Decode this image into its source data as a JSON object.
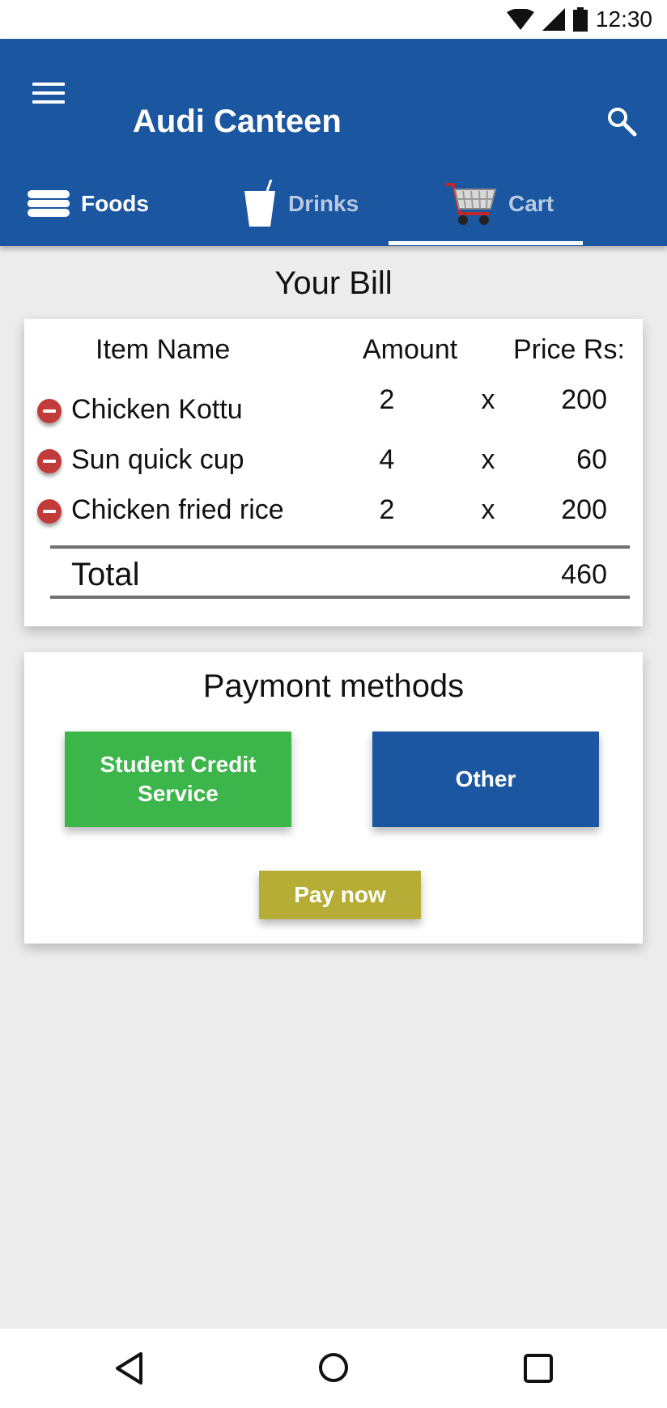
{
  "status_bar": {
    "time": "12:30"
  },
  "app_bar": {
    "title": "Audi Canteen"
  },
  "tabs": [
    {
      "label": "Foods",
      "icon": "burger-icon"
    },
    {
      "label": "Drinks",
      "icon": "drink-cup-icon"
    },
    {
      "label": "Cart",
      "icon": "shopping-cart-icon",
      "selected": true
    }
  ],
  "bill": {
    "title": "Your Bill",
    "headers": {
      "item": "Item Name",
      "amount": "Amount",
      "price": "Price Rs:"
    },
    "items": [
      {
        "name": "Chicken Kottu",
        "amount": "2",
        "times": "x",
        "price": "200"
      },
      {
        "name": "Sun quick cup",
        "amount": "4",
        "times": "x",
        "price": "60"
      },
      {
        "name": "Chicken fried rice",
        "amount": "2",
        "times": "x",
        "price": "200"
      }
    ],
    "total_label": "Total",
    "total_value": "460"
  },
  "payment": {
    "title": "Paymont methods",
    "student_credit_line1": "Student Credit",
    "student_credit_line2": "Service",
    "other": "Other",
    "pay_now": "Pay now"
  },
  "colors": {
    "primary": "#1b56a0",
    "student_credit": "#3cb54a",
    "pay_now": "#b5ad35",
    "remove": "#c23b3b",
    "background": "#ececec"
  }
}
